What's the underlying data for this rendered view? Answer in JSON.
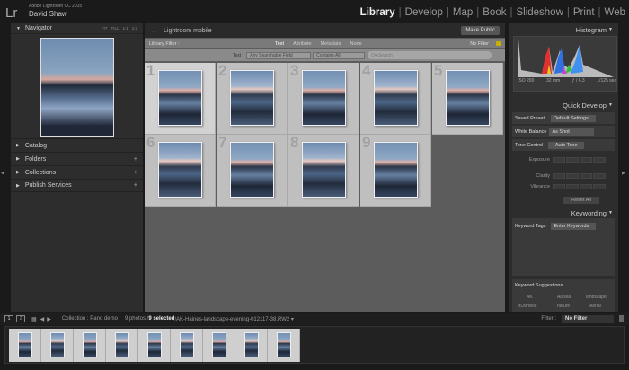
{
  "app": {
    "logo": "Lr",
    "product": "Adobe Lightroom CC 2015",
    "user": "David Shaw"
  },
  "modules": [
    {
      "label": "Library",
      "active": true
    },
    {
      "label": "Develop"
    },
    {
      "label": "Map"
    },
    {
      "label": "Book"
    },
    {
      "label": "Slideshow"
    },
    {
      "label": "Print"
    },
    {
      "label": "Web"
    }
  ],
  "left": {
    "navigator": {
      "title": "Navigator",
      "zoom": [
        "FIT",
        "FILL",
        "1:1",
        "1:2"
      ]
    },
    "sections": [
      {
        "label": "Catalog",
        "ctl": ""
      },
      {
        "label": "Folders",
        "ctl": "+"
      },
      {
        "label": "Collections",
        "ctl": "−  +"
      },
      {
        "label": "Publish Services",
        "ctl": "+"
      }
    ]
  },
  "center": {
    "mobile_label": "Lightroom mobile",
    "make_public": "Make Public",
    "filter": {
      "label": "Library Filter :",
      "tabs": [
        "Text",
        "Attribute",
        "Metadata",
        "None"
      ],
      "active_tab": "Text",
      "no_filter": "No Filter"
    },
    "text_filter": {
      "label": "Text",
      "field": "Any Searchable Field",
      "rule": "Contains All",
      "search_placeholder": "Search"
    },
    "grid": [
      "1",
      "2",
      "3",
      "4",
      "5",
      "6",
      "7",
      "8",
      "9"
    ]
  },
  "right": {
    "histogram": {
      "title": "Histogram",
      "iso": "ISO 200",
      "focal": "32 mm",
      "aperture": "ƒ / 6.3",
      "shutter": "1/125 sec"
    },
    "quick_develop": {
      "title": "Quick Develop",
      "saved_preset_label": "Saved Preset",
      "saved_preset": "Default Settings",
      "wb_label": "White Balance",
      "wb": "As Shot",
      "tone_label": "Tone Control",
      "auto_tone": "Auto Tone",
      "exposure": "Exposure",
      "clarity": "Clarity",
      "vibrance": "Vibrance",
      "reset": "Reset All"
    },
    "keywording": {
      "title": "Keywording",
      "tags_label": "Keyword Tags",
      "tags_value": "Enter Keywords",
      "suggestions_label": "Keyword Suggestions",
      "suggestions": [
        "AK",
        "Alaska",
        "landscape",
        "BLM/Wild",
        "nature",
        "Aerial"
      ]
    }
  },
  "bottom": {
    "pages": [
      "1",
      "2"
    ],
    "collection": "Collection : Pano demo",
    "count": "9 photos /",
    "selected": "9 selected",
    "file": "/AK-Haines-landscape-evening-012117-38.RW2 ▾",
    "filter_label": "Filter :",
    "filter_value": "No Filter"
  }
}
